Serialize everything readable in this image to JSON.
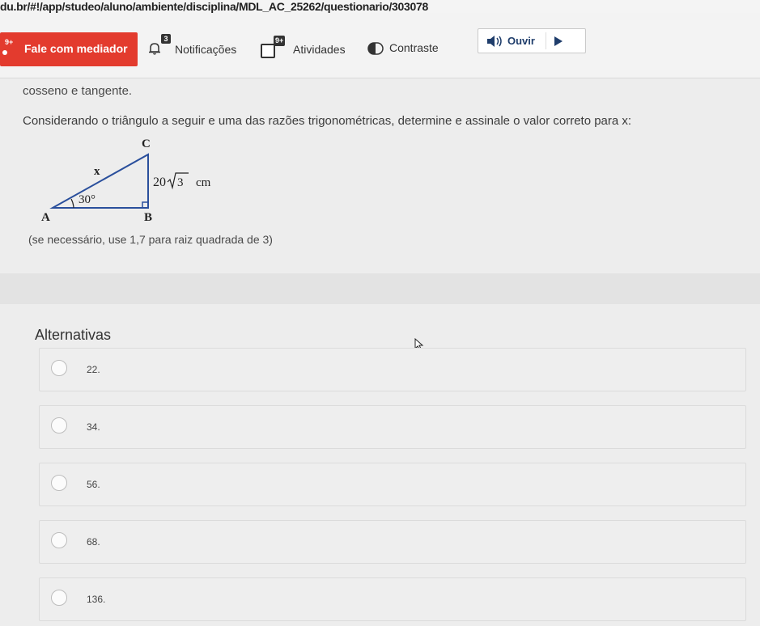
{
  "browser": {
    "url": "du.br/#!/app/studeo/aluno/ambiente/disciplina/MDL_AC_25262/questionario/303078"
  },
  "toolbar": {
    "mediator": {
      "label": "Fale com mediador",
      "badge": "9+"
    },
    "notifications": {
      "label": "Notificações",
      "badge": "3"
    },
    "activities": {
      "label": "Atividades",
      "badge": "9+"
    },
    "contrast": {
      "label": "Contraste"
    },
    "listen": {
      "label": "Ouvir"
    }
  },
  "question": {
    "intro_tail": "cosseno e tangente.",
    "prompt": "Considerando o triângulo a seguir e uma das razões trigonométricas, determine e assinale o valor correto para x:",
    "figure": {
      "vertex_a": "A",
      "vertex_b": "B",
      "vertex_c": "C",
      "hypotenuse_label": "x",
      "angle_label": "30°",
      "side_value": "20",
      "side_radicand": "3",
      "side_unit": "cm"
    },
    "hint": "(se necessário, use 1,7 para raiz quadrada de 3)"
  },
  "alternatives": {
    "title": "Alternativas",
    "options": [
      {
        "label": "22."
      },
      {
        "label": "34."
      },
      {
        "label": "56."
      },
      {
        "label": "68."
      },
      {
        "label": "136."
      }
    ]
  },
  "colors": {
    "mediator_bg": "#e33b2e",
    "listen_text": "#1f3d6b",
    "page_bg": "#ededed"
  }
}
